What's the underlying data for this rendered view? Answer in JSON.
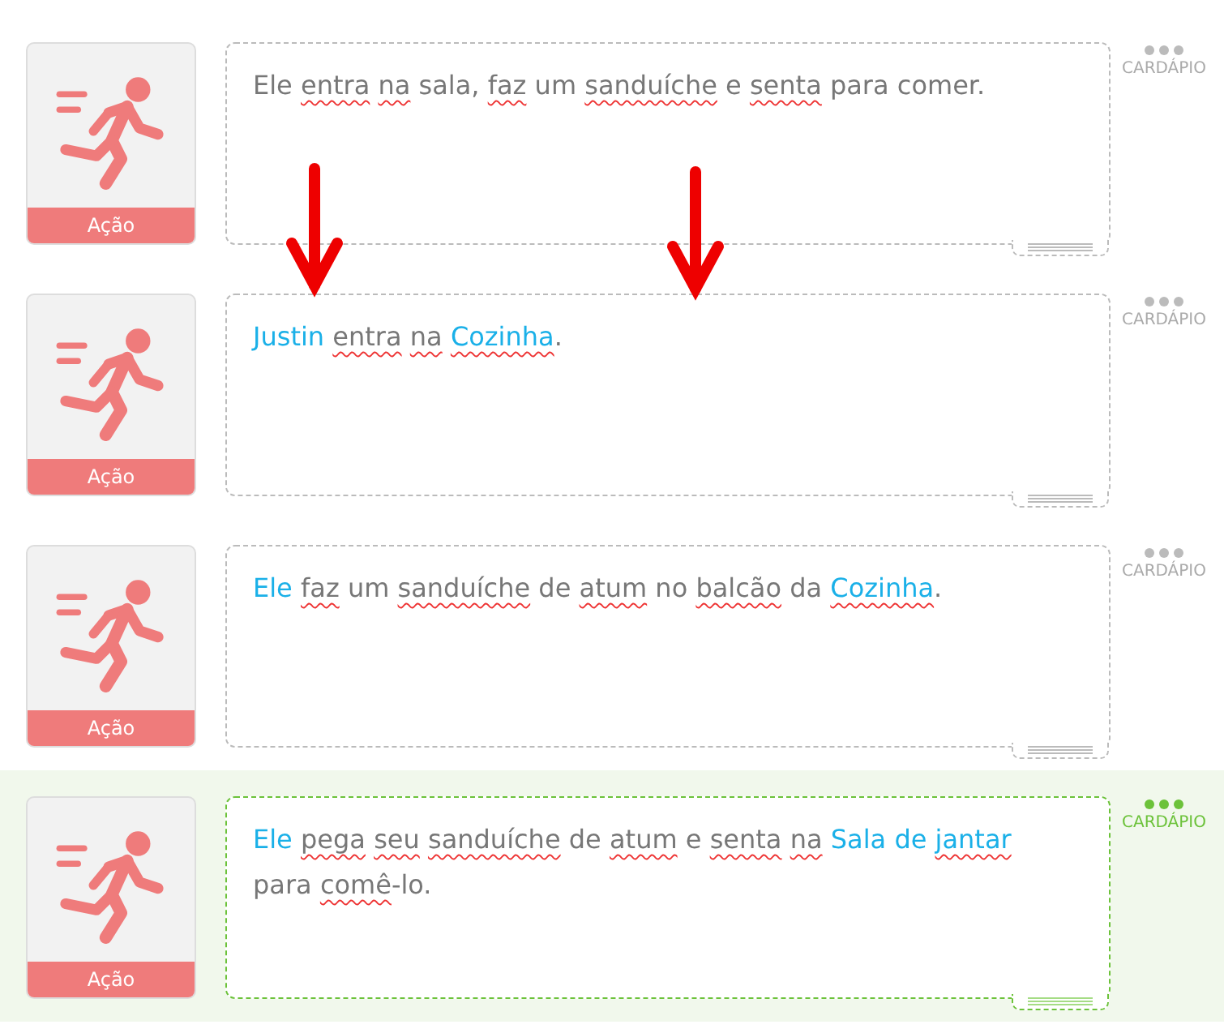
{
  "rows": [
    {
      "selected": false,
      "action_label": "Ação",
      "menu_label": "CARDÁPIO",
      "words": [
        {
          "text": "Ele",
          "tag": false,
          "misspelled": false
        },
        {
          "text": "entra",
          "tag": false,
          "misspelled": true
        },
        {
          "text": "na",
          "tag": false,
          "misspelled": true
        },
        {
          "text": "sala,",
          "tag": false,
          "misspelled": false
        },
        {
          "text": "faz",
          "tag": false,
          "misspelled": true
        },
        {
          "text": "um",
          "tag": false,
          "misspelled": false
        },
        {
          "text": "sanduíche",
          "tag": false,
          "misspelled": true
        },
        {
          "text": "e",
          "tag": false,
          "misspelled": false
        },
        {
          "text": "senta",
          "tag": false,
          "misspelled": true
        },
        {
          "text": "para",
          "tag": false,
          "misspelled": false
        },
        {
          "text": "comer.",
          "tag": false,
          "misspelled": false
        }
      ]
    },
    {
      "selected": false,
      "action_label": "Ação",
      "menu_label": "CARDÁPIO",
      "words": [
        {
          "text": "Justin",
          "tag": true,
          "misspelled": false
        },
        {
          "text": "entra",
          "tag": false,
          "misspelled": true
        },
        {
          "text": "na",
          "tag": false,
          "misspelled": true
        },
        {
          "text": "Cozinha",
          "tag": true,
          "misspelled": true,
          "after": "."
        }
      ]
    },
    {
      "selected": false,
      "action_label": "Ação",
      "menu_label": "CARDÁPIO",
      "words": [
        {
          "text": "Ele",
          "tag": true,
          "misspelled": false
        },
        {
          "text": "faz",
          "tag": false,
          "misspelled": true
        },
        {
          "text": "um",
          "tag": false,
          "misspelled": false
        },
        {
          "text": "sanduíche",
          "tag": false,
          "misspelled": true
        },
        {
          "text": "de",
          "tag": false,
          "misspelled": false
        },
        {
          "text": "atum",
          "tag": false,
          "misspelled": true
        },
        {
          "text": "no",
          "tag": false,
          "misspelled": false
        },
        {
          "text": "balcão",
          "tag": false,
          "misspelled": true
        },
        {
          "text": "da",
          "tag": false,
          "misspelled": false
        },
        {
          "text": "Cozinha",
          "tag": true,
          "misspelled": true,
          "after": "."
        }
      ]
    },
    {
      "selected": true,
      "action_label": "Ação",
      "menu_label": "CARDÁPIO",
      "words": [
        {
          "text": "Ele",
          "tag": true,
          "misspelled": false
        },
        {
          "text": "pega",
          "tag": false,
          "misspelled": true
        },
        {
          "text": "seu",
          "tag": false,
          "misspelled": true
        },
        {
          "text": "sanduíche",
          "tag": false,
          "misspelled": true
        },
        {
          "text": "de",
          "tag": false,
          "misspelled": false
        },
        {
          "text": "atum",
          "tag": false,
          "misspelled": true
        },
        {
          "text": "e",
          "tag": false,
          "misspelled": false
        },
        {
          "text": "senta",
          "tag": false,
          "misspelled": true
        },
        {
          "text": "na",
          "tag": false,
          "misspelled": true
        },
        {
          "text": "Sala",
          "tag": true,
          "misspelled": false
        },
        {
          "text": "de",
          "tag": true,
          "misspelled": false
        },
        {
          "text": "jantar",
          "tag": true,
          "misspelled": true
        },
        {
          "text": "para",
          "tag": false,
          "misspelled": false
        },
        {
          "text": "comê",
          "tag": false,
          "misspelled": true,
          "after": "-lo."
        }
      ]
    }
  ]
}
